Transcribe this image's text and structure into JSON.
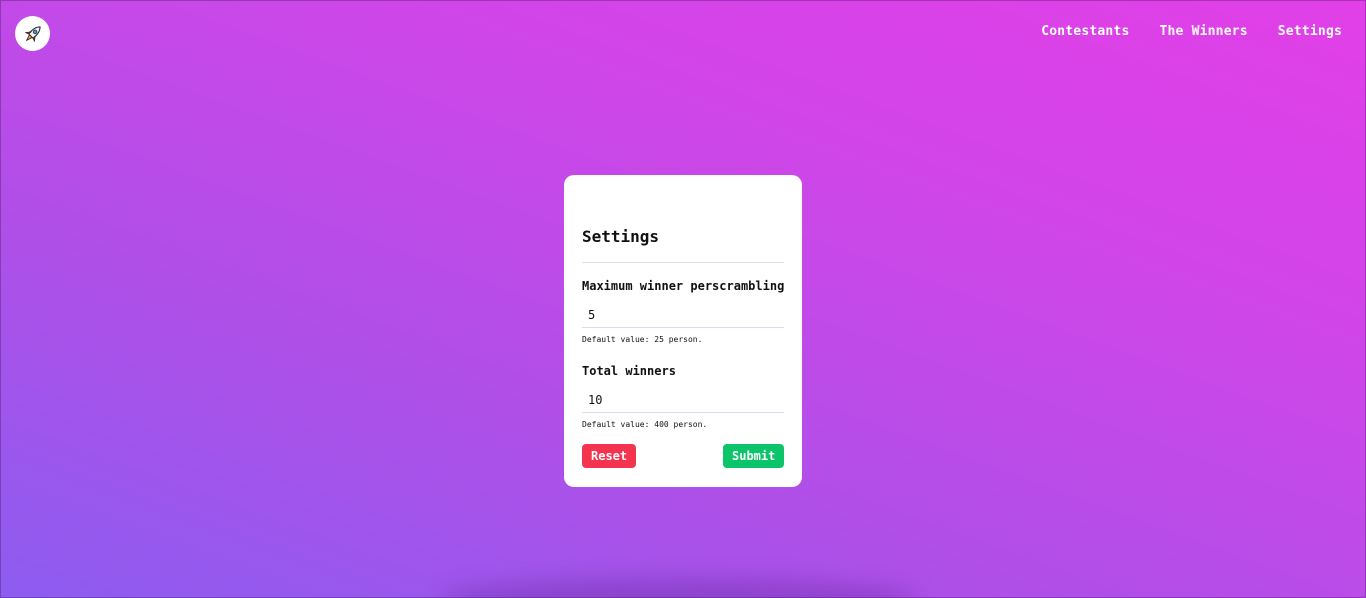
{
  "header": {
    "logo_icon": "rocket-icon",
    "nav": [
      {
        "label": "Contestants"
      },
      {
        "label": "The Winners"
      },
      {
        "label": "Settings"
      }
    ]
  },
  "settings": {
    "title": "Settings",
    "fields": [
      {
        "label": "Maximum winner perscrambling",
        "value": "5",
        "hint": "Default value: 25 person."
      },
      {
        "label": "Total winners",
        "value": "10",
        "hint": "Default value: 400 person."
      }
    ],
    "reset_label": "Reset",
    "submit_label": "Submit"
  },
  "colors": {
    "reset": "#f4334f",
    "submit": "#0cc46a",
    "gradient_start": "#8d5cf0",
    "gradient_end": "#e23fe8"
  }
}
